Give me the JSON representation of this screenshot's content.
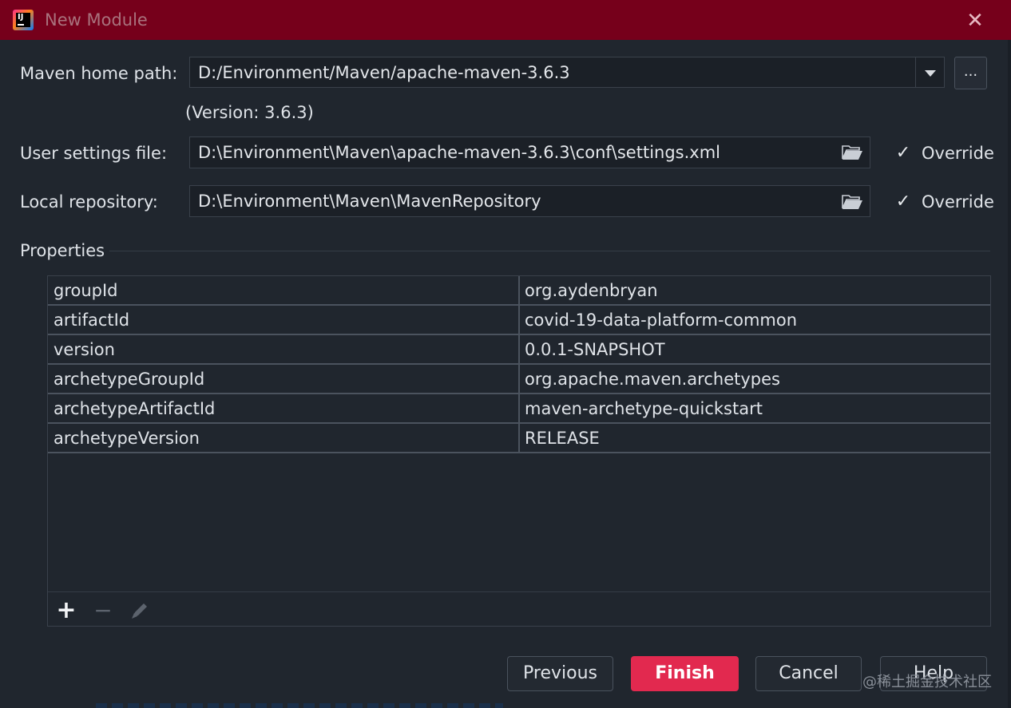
{
  "window": {
    "title": "New Module",
    "close_glyph": "✕",
    "accent_color": "#76001b"
  },
  "maven": {
    "home_label": "Maven home path:",
    "home_value": "D:/Environment/Maven/apache-maven-3.6.3",
    "browse_label": "...",
    "version_text": "(Version: 3.6.3)",
    "settings_label": "User settings file:",
    "settings_value": "D:\\Environment\\Maven\\apache-maven-3.6.3\\conf\\settings.xml",
    "settings_override": "Override",
    "repo_label": "Local repository:",
    "repo_value": "D:\\Environment\\Maven\\MavenRepository",
    "repo_override": "Override",
    "check_glyph": "✓"
  },
  "properties": {
    "section_title": "Properties",
    "rows": [
      {
        "key": "groupId",
        "value": "org.aydenbryan"
      },
      {
        "key": "artifactId",
        "value": "covid-19-data-platform-common"
      },
      {
        "key": "version",
        "value": "0.0.1-SNAPSHOT"
      },
      {
        "key": "archetypeGroupId",
        "value": "org.apache.maven.archetypes"
      },
      {
        "key": "archetypeArtifactId",
        "value": "maven-archetype-quickstart"
      },
      {
        "key": "archetypeVersion",
        "value": "RELEASE"
      }
    ],
    "add_glyph": "+",
    "remove_glyph": "−"
  },
  "footer": {
    "previous": "Previous",
    "finish": "Finish",
    "cancel": "Cancel",
    "help": "Help",
    "primary_color": "#e2294f"
  },
  "watermark": "@稀土掘金技术社区"
}
